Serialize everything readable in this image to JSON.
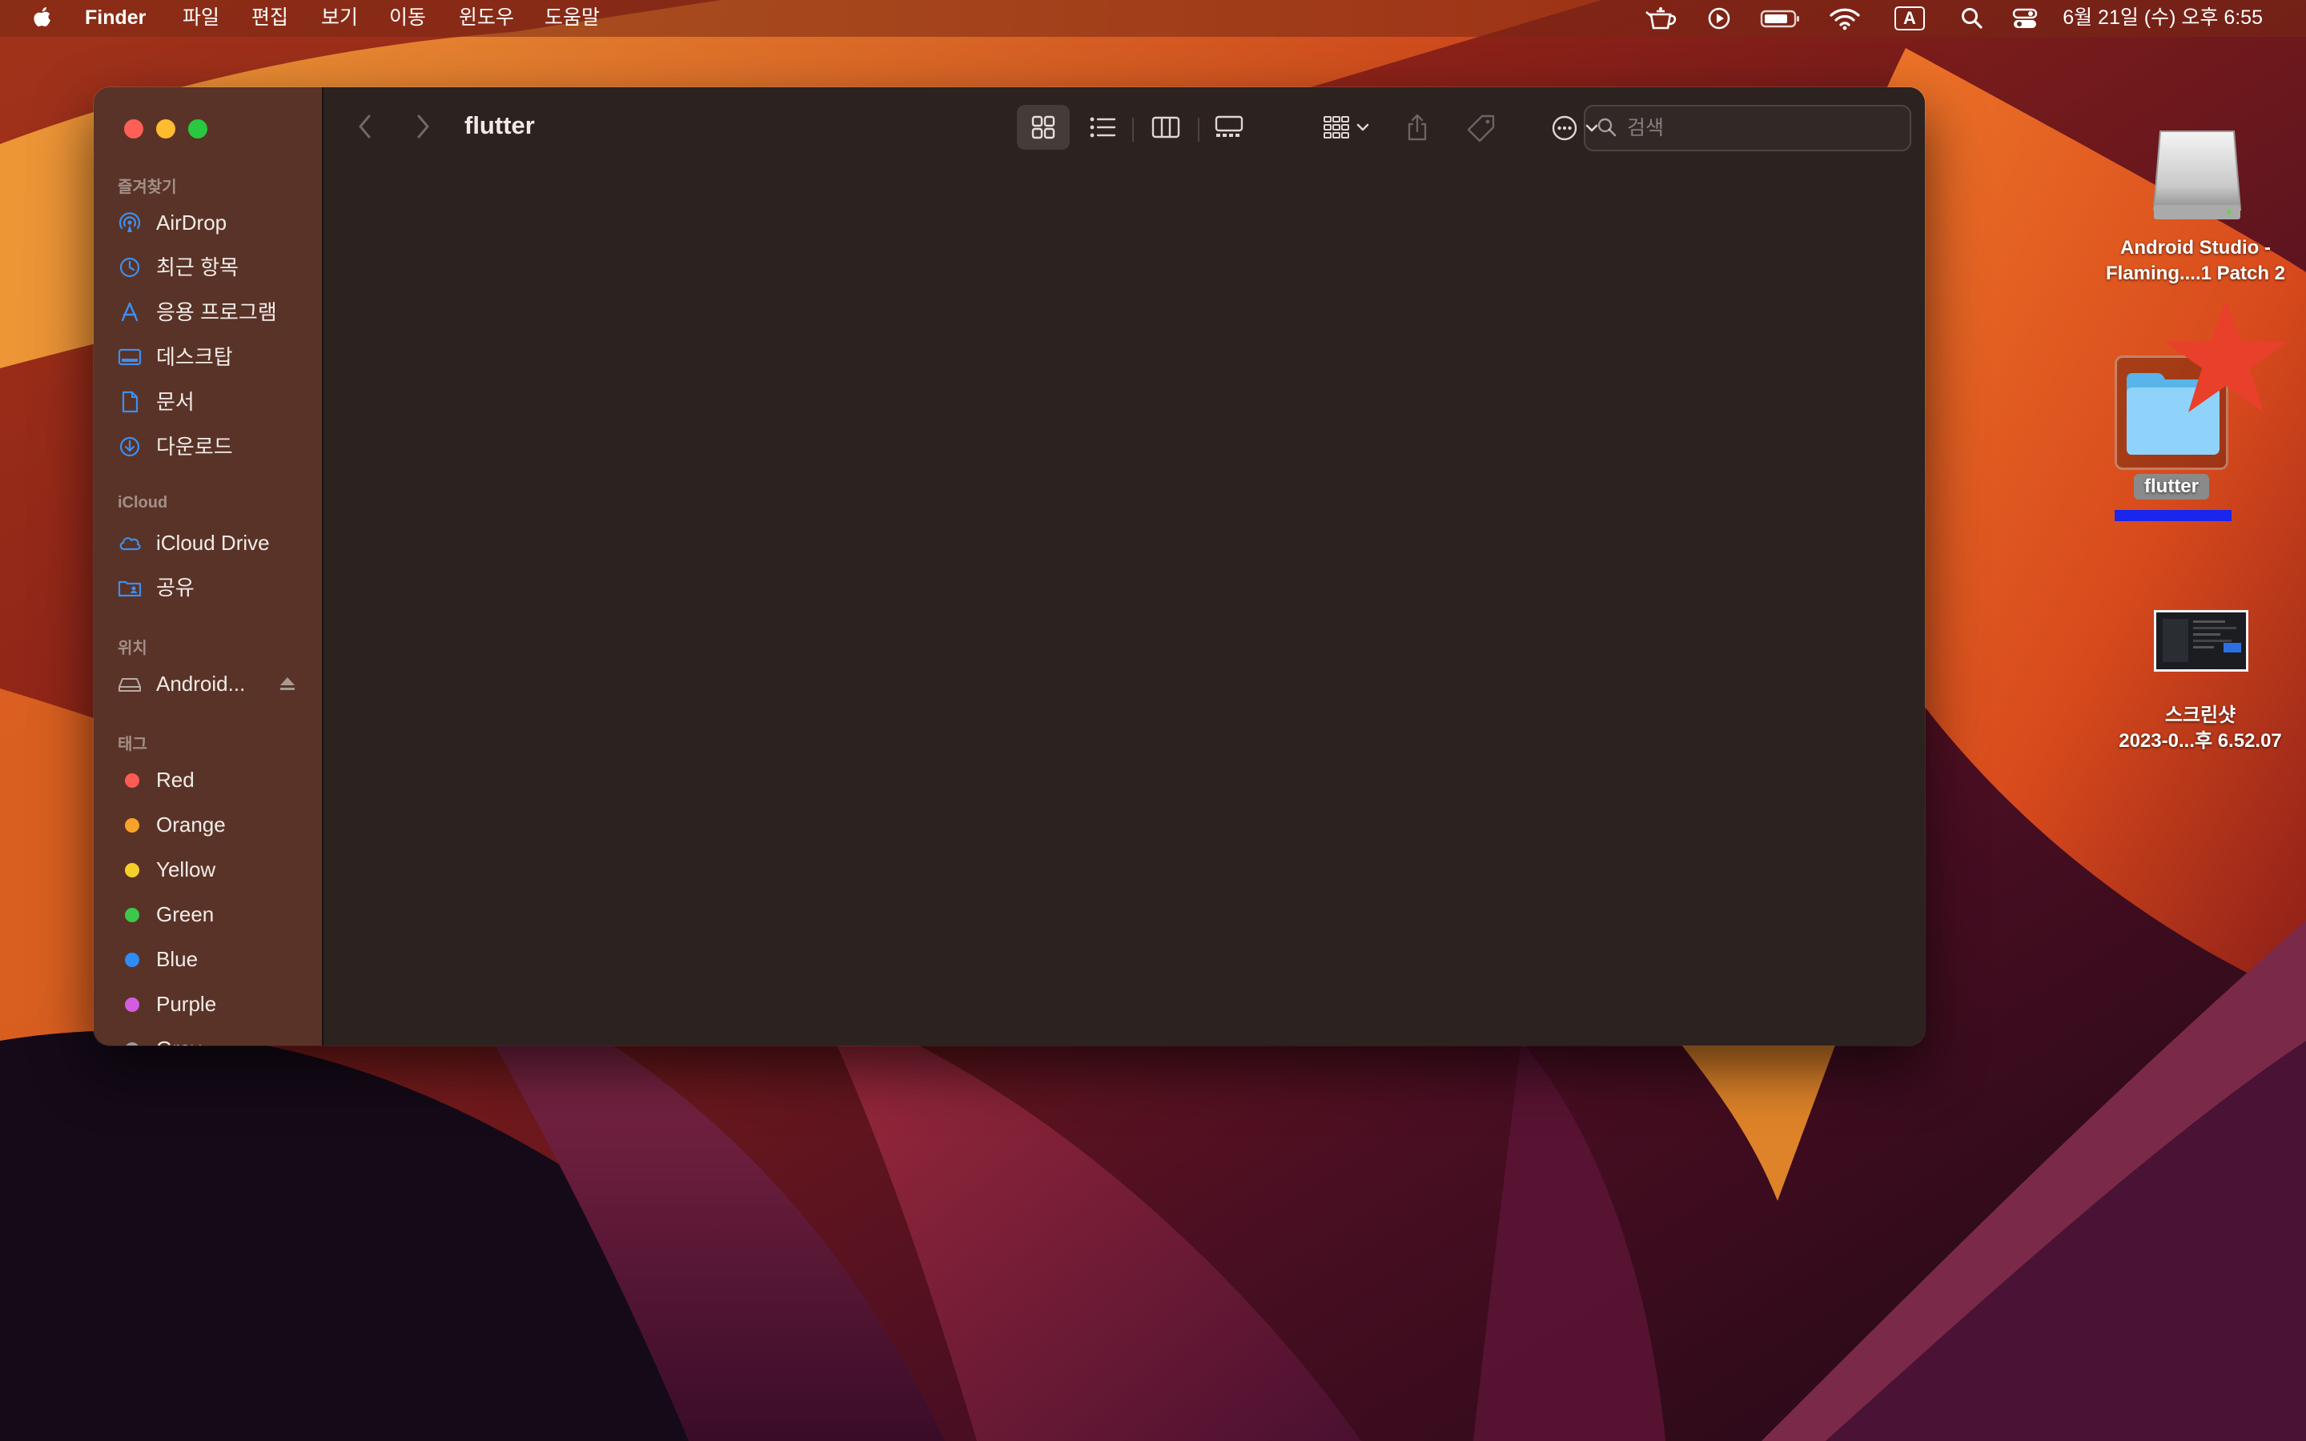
{
  "menubar": {
    "app_name": "Finder",
    "menus": [
      "파일",
      "편집",
      "보기",
      "이동",
      "윈도우",
      "도움말"
    ],
    "clock": "6월 21일 (수) 오후 6:55",
    "input_source": "A"
  },
  "window": {
    "title": "flutter",
    "search_placeholder": "검색"
  },
  "sidebar": {
    "favorites_title": "즐겨찾기",
    "favorites": [
      {
        "label": "AirDrop",
        "icon": "airdrop-icon"
      },
      {
        "label": "최근 항목",
        "icon": "clock-icon"
      },
      {
        "label": "응용 프로그램",
        "icon": "applications-icon"
      },
      {
        "label": "데스크탑",
        "icon": "desktop-icon"
      },
      {
        "label": "문서",
        "icon": "document-icon"
      },
      {
        "label": "다운로드",
        "icon": "download-icon"
      }
    ],
    "icloud_title": "iCloud",
    "icloud": [
      {
        "label": "iCloud Drive",
        "icon": "cloud-icon"
      },
      {
        "label": "공유",
        "icon": "shared-folder-icon"
      }
    ],
    "locations_title": "위치",
    "locations": [
      {
        "label": "Android...",
        "icon": "disk-icon"
      }
    ],
    "tags_title": "태그",
    "tags": [
      {
        "label": "Red",
        "color": "#ff5b55"
      },
      {
        "label": "Orange",
        "color": "#f7a32a"
      },
      {
        "label": "Yellow",
        "color": "#f5d02b"
      },
      {
        "label": "Green",
        "color": "#3cc84a"
      },
      {
        "label": "Blue",
        "color": "#2f8cf5"
      },
      {
        "label": "Purple",
        "color": "#d35ce0"
      },
      {
        "label": "Gray",
        "color": "#9a9a9a"
      }
    ]
  },
  "desktop": {
    "disk_label_1": "Android Studio -",
    "disk_label_2": "Flaming....1 Patch 2",
    "folder_label": "flutter",
    "screenshot_label_1": "스크린샷",
    "screenshot_label_2": "2023-0...후 6.52.07"
  }
}
